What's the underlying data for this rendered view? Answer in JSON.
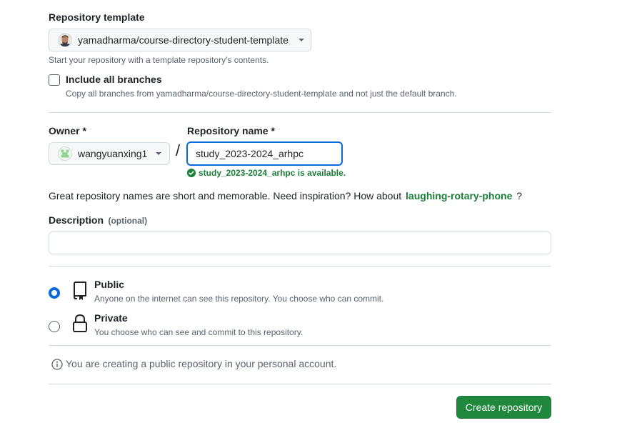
{
  "template": {
    "label": "Repository template",
    "selected": "yamadharma/course-directory-student-template",
    "hint": "Start your repository with a template repository's contents."
  },
  "branches": {
    "label": "Include all branches",
    "hint": "Copy all branches from yamadharma/course-directory-student-template and not just the default branch.",
    "checked": false
  },
  "owner": {
    "label": "Owner *",
    "value": "wangyuanxing1"
  },
  "separator": "/",
  "repo_name": {
    "label": "Repository name *",
    "value": "study_2023-2024_arhpc",
    "availability": "study_2023-2024_arhpc is available."
  },
  "suggestion": {
    "text": "Great repository names are short and memorable. Need inspiration? How about",
    "name": "laughing-rotary-phone",
    "end": "?"
  },
  "description": {
    "label": "Description",
    "optional": "(optional)",
    "value": ""
  },
  "visibility": {
    "options": [
      {
        "title": "Public",
        "desc": "Anyone on the internet can see this repository. You choose who can commit.",
        "icon": "repo-icon",
        "checked": true
      },
      {
        "title": "Private",
        "desc": "You choose who can see and commit to this repository.",
        "icon": "lock-icon",
        "checked": false
      }
    ]
  },
  "info": {
    "text": "You are creating a public repository in your personal account.",
    "icon": "info-icon"
  },
  "create_button": "Create repository",
  "colors": {
    "accent": "#0969da",
    "success": "#1a7f37",
    "button_green": "#1f883d"
  }
}
